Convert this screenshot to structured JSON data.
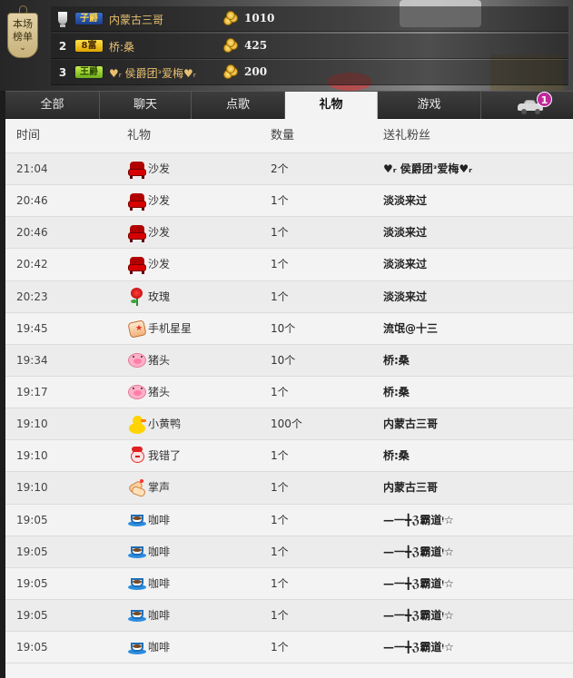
{
  "rank_board": {
    "badge_label_line1": "本场",
    "badge_label_line2": "榜单",
    "badge_chevron": "⌄",
    "entries": [
      {
        "rank": "",
        "level": "子爵",
        "name": "内蒙古三哥",
        "score": "1010",
        "level_class": "lvl-1"
      },
      {
        "rank": "2",
        "level": "8富",
        "name": "桥:桑",
        "score": "425",
        "level_class": "lvl-2"
      },
      {
        "rank": "3",
        "level": "王爵",
        "name": "♥ᵣ 侯爵团ᵌ爱梅♥ᵣ",
        "score": "200",
        "level_class": "lvl-3"
      }
    ]
  },
  "tabs": [
    {
      "label": "全部",
      "active": false
    },
    {
      "label": "聊天",
      "active": false
    },
    {
      "label": "点歌",
      "active": false
    },
    {
      "label": "礼物",
      "active": true
    },
    {
      "label": "游戏",
      "active": false
    }
  ],
  "car": {
    "icon": "car-icon",
    "badge_count": "1"
  },
  "table": {
    "headers": {
      "time": "时间",
      "gift": "礼物",
      "qty": "数量",
      "fan": "送礼粉丝"
    },
    "rows": [
      {
        "time": "21:04",
        "gift": "沙发",
        "icon": "sofa",
        "qty": "2个",
        "fan": "♥ᵣ 侯爵团ᵌ爱梅♥ᵣ"
      },
      {
        "time": "20:46",
        "gift": "沙发",
        "icon": "sofa",
        "qty": "1个",
        "fan": "淡淡来过"
      },
      {
        "time": "20:46",
        "gift": "沙发",
        "icon": "sofa",
        "qty": "1个",
        "fan": "淡淡来过"
      },
      {
        "time": "20:42",
        "gift": "沙发",
        "icon": "sofa",
        "qty": "1个",
        "fan": "淡淡来过"
      },
      {
        "time": "20:23",
        "gift": "玫瑰",
        "icon": "rose",
        "qty": "1个",
        "fan": "淡淡来过"
      },
      {
        "time": "19:45",
        "gift": "手机星星",
        "icon": "phone",
        "qty": "10个",
        "fan": "流氓@十三"
      },
      {
        "time": "19:34",
        "gift": "猪头",
        "icon": "pig",
        "qty": "10个",
        "fan": "桥:桑"
      },
      {
        "time": "19:17",
        "gift": "猪头",
        "icon": "pig",
        "qty": "1个",
        "fan": "桥:桑"
      },
      {
        "time": "19:10",
        "gift": "小黄鸭",
        "icon": "duck",
        "qty": "100个",
        "fan": "内蒙古三哥"
      },
      {
        "time": "19:10",
        "gift": "我错了",
        "icon": "sorry",
        "qty": "1个",
        "fan": "桥:桑"
      },
      {
        "time": "19:10",
        "gift": "掌声",
        "icon": "clap",
        "qty": "1个",
        "fan": "内蒙古三哥"
      },
      {
        "time": "19:05",
        "gift": "咖啡",
        "icon": "coffee",
        "qty": "1个",
        "fan": "—一╋ℨ霸道ᵎ☆"
      },
      {
        "time": "19:05",
        "gift": "咖啡",
        "icon": "coffee",
        "qty": "1个",
        "fan": "—一╋ℨ霸道ᵎ☆"
      },
      {
        "time": "19:05",
        "gift": "咖啡",
        "icon": "coffee",
        "qty": "1个",
        "fan": "—一╋ℨ霸道ᵎ☆"
      },
      {
        "time": "19:05",
        "gift": "咖啡",
        "icon": "coffee",
        "qty": "1个",
        "fan": "—一╋ℨ霸道ᵎ☆"
      },
      {
        "time": "19:05",
        "gift": "咖啡",
        "icon": "coffee",
        "qty": "1个",
        "fan": "—一╋ℨ霸道ᵎ☆"
      }
    ]
  }
}
